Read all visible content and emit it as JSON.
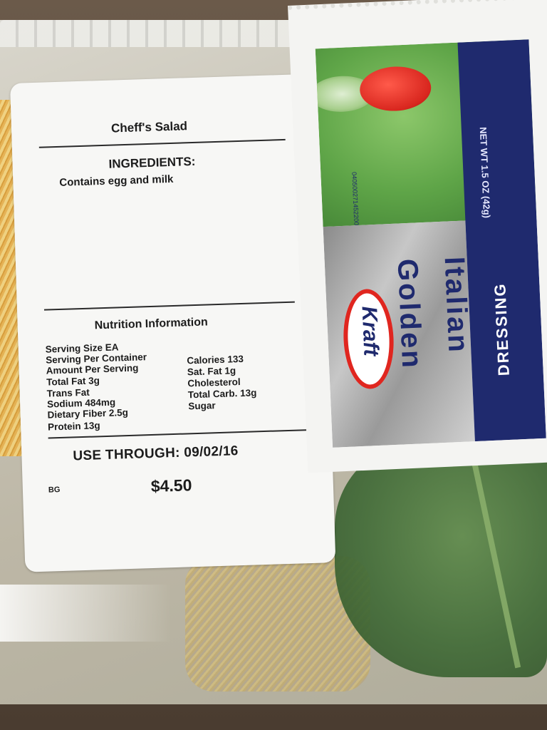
{
  "label": {
    "title": "Cheff's Salad",
    "ingredients_heading": "INGREDIENTS:",
    "ingredients_text": "Contains egg and milk",
    "nutrition_heading": "Nutrition Information",
    "nutrition_left": [
      "Serving Size EA",
      "Serving Per Container",
      "Amount Per Serving",
      "Total Fat 3g",
      "Trans Fat",
      "Sodium 484mg",
      "Dietary Fiber 2.5g",
      "Protein 13g"
    ],
    "nutrition_right": [
      "Calories 133",
      "Sat. Fat 1g",
      "Cholesterol",
      "Total Carb. 13g",
      "Sugar"
    ],
    "use_through": "USE THROUGH:  09/02/16",
    "store_code": "BG",
    "price": "$4.50"
  },
  "packet": {
    "brand": "Kraft",
    "word1": "Golden",
    "word2": "Italian",
    "band_word": "DRESSING",
    "barcode": "040500271452200",
    "net_wt": "NET WT 1.5 OZ (42g)",
    "number": "9"
  },
  "colors": {
    "kraft_navy": "#1f2a6e",
    "kraft_red": "#e0261f",
    "label_white": "#f7f7f5"
  }
}
